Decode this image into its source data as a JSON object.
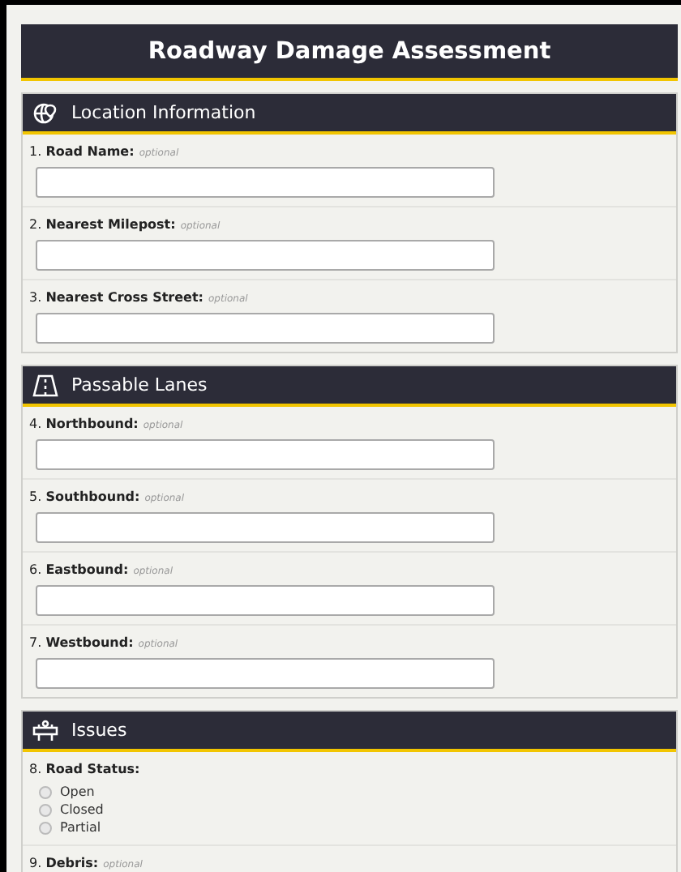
{
  "title": "Roadway Damage Assessment",
  "sections": [
    {
      "title": "Location Information",
      "fields": [
        {
          "number": "1.",
          "label": "Road Name:",
          "hint": "optional",
          "kind": "text"
        },
        {
          "number": "2.",
          "label": "Nearest Milepost:",
          "hint": "optional",
          "kind": "text"
        },
        {
          "number": "3.",
          "label": "Nearest Cross Street:",
          "hint": "optional",
          "kind": "text"
        }
      ]
    },
    {
      "title": "Passable Lanes",
      "fields": [
        {
          "number": "4.",
          "label": "Northbound:",
          "hint": "optional",
          "kind": "text"
        },
        {
          "number": "5.",
          "label": "Southbound:",
          "hint": "optional",
          "kind": "text"
        },
        {
          "number": "6.",
          "label": "Eastbound:",
          "hint": "optional",
          "kind": "text"
        },
        {
          "number": "7.",
          "label": "Westbound:",
          "hint": "optional",
          "kind": "text"
        }
      ]
    },
    {
      "title": "Issues",
      "fields": [
        {
          "number": "8.",
          "label": "Road Status:",
          "kind": "radio",
          "options": [
            {
              "label": "Open",
              "selected": false
            },
            {
              "label": "Closed",
              "selected": false
            },
            {
              "label": "Partial",
              "selected": false
            }
          ]
        },
        {
          "number": "9.",
          "label": "Debris:",
          "hint": "optional",
          "kind": "label"
        }
      ]
    }
  ]
}
